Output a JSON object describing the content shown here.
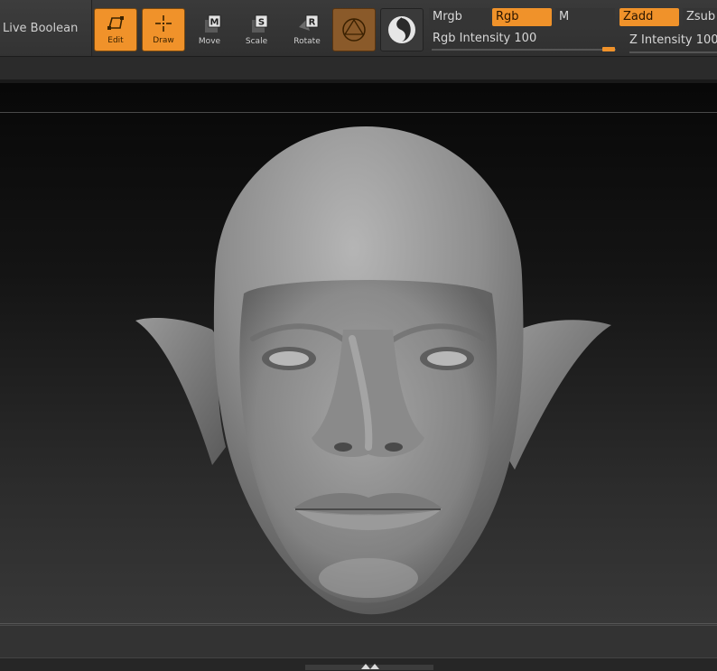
{
  "toolbar": {
    "live_boolean_label": "Live Boolean",
    "tools": [
      {
        "label": "Edit",
        "icon": "edit-icon",
        "active": true
      },
      {
        "label": "Draw",
        "icon": "draw-icon",
        "active": true
      },
      {
        "label": "Move",
        "icon": "move-icon",
        "active": false,
        "key": "M"
      },
      {
        "label": "Scale",
        "icon": "scale-icon",
        "active": false,
        "key": "S"
      },
      {
        "label": "Rotate",
        "icon": "rotate-icon",
        "active": false,
        "key": "R"
      }
    ],
    "material_icon": "material-sphere-icon",
    "stroke_icon": "stroke-icon",
    "mrgb_label": "Mrgb",
    "rgb_label": "Rgb",
    "m_label": "M",
    "rgb_intensity_label": "Rgb Intensity",
    "rgb_intensity_value": "100",
    "zadd_label": "Zadd",
    "zsub_label": "Zsub",
    "z_intensity_label": "Z Intensity",
    "z_intensity_value": "100"
  },
  "colors": {
    "accent": "#f0922a",
    "panel": "#333333",
    "viewport_top": "#080808",
    "viewport_bottom": "#383838"
  },
  "canvas": {
    "subject": "elf-head-sculpt"
  }
}
